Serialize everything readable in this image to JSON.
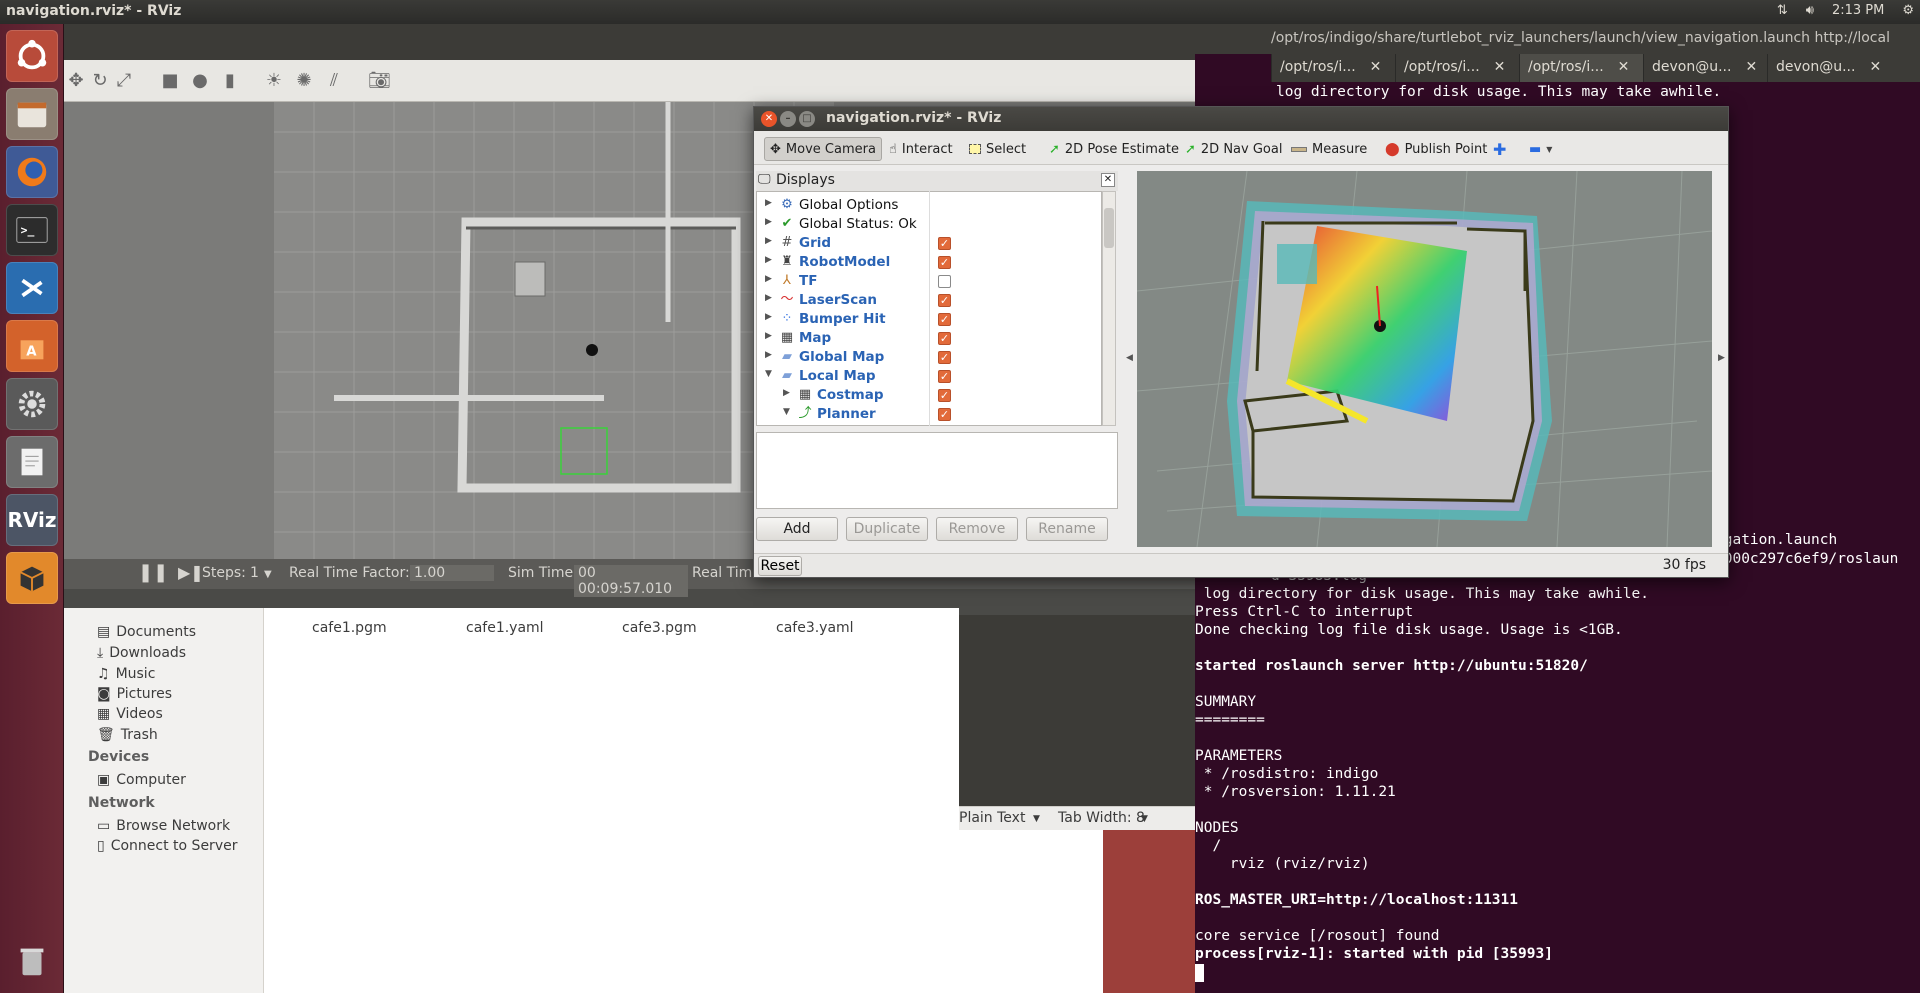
{
  "top_panel": {
    "window_title": "navigation.rviz* - RViz",
    "clock": "2:13 PM",
    "icons": [
      "network-arrows-icon",
      "volume-icon",
      "gear-icon"
    ]
  },
  "launcher": {
    "items": [
      "ubuntu-dash-icon",
      "files-icon",
      "firefox-icon",
      "terminal-icon",
      "vscode-icon",
      "software-center-icon",
      "system-settings-icon",
      "text-editor-icon",
      "rviz-icon",
      "gazebo-icon",
      "trash-icon"
    ],
    "rviz_label": "RViz"
  },
  "gazebo": {
    "steps_label": "Steps:",
    "steps_value": "1",
    "rtf_label": "Real Time Factor:",
    "rtf_value": "1.00",
    "sim_time_label": "Sim Time:",
    "sim_time_value": "00 00:09:57.010",
    "real_time_label": "Real Time"
  },
  "files": {
    "sidebar": {
      "places": [
        "Documents",
        "Downloads",
        "Music",
        "Pictures",
        "Videos",
        "Trash"
      ],
      "devices_header": "Devices",
      "devices": [
        "Computer"
      ],
      "network_header": "Network",
      "network": [
        "Browse Network",
        "Connect to Server"
      ]
    },
    "items": [
      "cafe1.pgm",
      "cafe1.yaml",
      "cafe3.pgm",
      "cafe3.yaml"
    ]
  },
  "gedit": {
    "syntax": "Plain Text",
    "tab_width": "Tab Width: 8"
  },
  "terminal": {
    "path": "/opt/ros/indigo/share/turtlebot_rviz_launchers/launch/view_navigation.launch http://local",
    "tabs": [
      "/opt/ros/i...",
      "/opt/ros/i...",
      "/opt/ros/i...",
      "devon@u...",
      "devon@u..."
    ],
    "top_line": "log directory for disk usage. This may take awhile.",
    "partial_launch": "igation.launch",
    "partial_log": "-000c297c6ef9/roslaun",
    "partial_file": "d-35985.log",
    "lines": [
      {
        "text": " log directory for disk usage. This may take awhile.",
        "bold": false
      },
      {
        "text": "Press Ctrl-C to interrupt",
        "bold": false
      },
      {
        "text": "Done checking log file disk usage. Usage is <1GB.",
        "bold": false
      },
      {
        "text": "",
        "bold": false
      },
      {
        "text": "started roslaunch server http://ubuntu:51820/",
        "bold": true
      },
      {
        "text": "",
        "bold": false
      },
      {
        "text": "SUMMARY",
        "bold": false
      },
      {
        "text": "========",
        "bold": false
      },
      {
        "text": "",
        "bold": false
      },
      {
        "text": "PARAMETERS",
        "bold": false
      },
      {
        "text": " * /rosdistro: indigo",
        "bold": false
      },
      {
        "text": " * /rosversion: 1.11.21",
        "bold": false
      },
      {
        "text": "",
        "bold": false
      },
      {
        "text": "NODES",
        "bold": false
      },
      {
        "text": "  /",
        "bold": false
      },
      {
        "text": "    rviz (rviz/rviz)",
        "bold": false
      },
      {
        "text": "",
        "bold": false
      },
      {
        "text": "ROS_MASTER_URI=http://localhost:11311",
        "bold": true
      },
      {
        "text": "",
        "bold": false
      },
      {
        "text": "core service [/rosout] found",
        "bold": false
      },
      {
        "text": "process[rviz-1]: started with pid [35993]",
        "bold": true
      }
    ]
  },
  "rviz": {
    "title": "navigation.rviz* - RViz",
    "tools": [
      "Move Camera",
      "Interact",
      "Select",
      "2D Pose Estimate",
      "2D Nav Goal",
      "Measure",
      "Publish Point"
    ],
    "panel_title": "Displays",
    "displays": [
      {
        "label": "Global Options",
        "icon": "gear-icon",
        "bold": false,
        "checked": null,
        "indent": 0,
        "expanded": false
      },
      {
        "label": "Global Status: Ok",
        "icon": "check-icon",
        "bold": false,
        "checked": null,
        "indent": 0,
        "expanded": false
      },
      {
        "label": "Grid",
        "icon": "grid-icon",
        "bold": true,
        "checked": true,
        "indent": 0,
        "expanded": false
      },
      {
        "label": "RobotModel",
        "icon": "robot-icon",
        "bold": true,
        "checked": true,
        "indent": 0,
        "expanded": false
      },
      {
        "label": "TF",
        "icon": "axes-icon",
        "bold": true,
        "checked": false,
        "indent": 0,
        "expanded": false
      },
      {
        "label": "LaserScan",
        "icon": "laser-icon",
        "bold": true,
        "checked": true,
        "indent": 0,
        "expanded": false
      },
      {
        "label": "Bumper Hit",
        "icon": "points-icon",
        "bold": true,
        "checked": true,
        "indent": 0,
        "expanded": false
      },
      {
        "label": "Map",
        "icon": "map-icon",
        "bold": true,
        "checked": true,
        "indent": 0,
        "expanded": false
      },
      {
        "label": "Global Map",
        "icon": "folder-icon",
        "bold": true,
        "checked": true,
        "indent": 0,
        "expanded": false
      },
      {
        "label": "Local Map",
        "icon": "folder-icon",
        "bold": true,
        "checked": true,
        "indent": 0,
        "expanded": true
      },
      {
        "label": "Costmap",
        "icon": "map-icon",
        "bold": true,
        "checked": true,
        "indent": 1,
        "expanded": false
      },
      {
        "label": "Planner",
        "icon": "path-icon",
        "bold": true,
        "checked": true,
        "indent": 1,
        "expanded": true
      }
    ],
    "buttons": {
      "add": "Add",
      "duplicate": "Duplicate",
      "remove": "Remove",
      "rename": "Rename"
    },
    "reset": "Reset",
    "fps": "30 fps",
    "colors": {
      "checkbox_on": "#e26a3a",
      "label_blue": "#2a63b4",
      "terminal_bg": "#300a24"
    }
  }
}
